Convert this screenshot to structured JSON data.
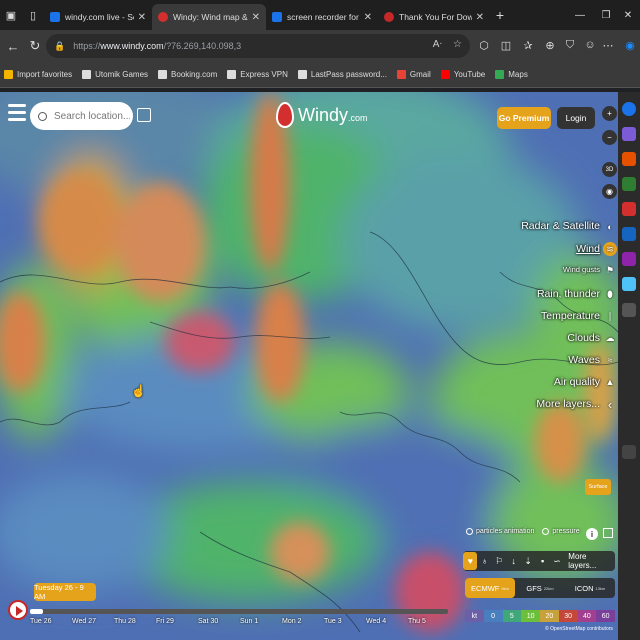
{
  "browser": {
    "tabs": [
      {
        "title": "windy.com live - Search",
        "active": false,
        "favicon_color": "#1a73e8"
      },
      {
        "title": "Windy: Wind map & weather fore",
        "active": true,
        "favicon_color": "#d32f2f"
      },
      {
        "title": "screen recorder for windows 11",
        "active": false,
        "favicon_color": "#1a73e8"
      },
      {
        "title": "Thank You For Downloading Scr",
        "active": false,
        "favicon_color": "#c62828"
      }
    ],
    "new_tab_label": "+",
    "url_prefix": "https://",
    "url_host": "www.windy.com",
    "url_path": "/?76.269,140.098,3",
    "bookmarks": [
      {
        "label": "Import favorites",
        "color": "#f4b400"
      },
      {
        "label": "Utomik Games",
        "color": "#ddd"
      },
      {
        "label": "Booking.com",
        "color": "#ddd"
      },
      {
        "label": "Express VPN",
        "color": "#ddd"
      },
      {
        "label": "LastPass password...",
        "color": "#ddd"
      },
      {
        "label": "Gmail",
        "color": "#ea4335"
      },
      {
        "label": "YouTube",
        "color": "#ff0000"
      },
      {
        "label": "Maps",
        "color": "#34a853"
      }
    ]
  },
  "app": {
    "search_placeholder": "Search location...",
    "logo_text": "Windy",
    "logo_suffix": ".com",
    "premium_label": "Go Premium",
    "login_label": "Login",
    "btn_3d": "3D",
    "layers": [
      {
        "label": "Radar & Satellite",
        "icon": "satellite-icon",
        "glyph": "◐"
      },
      {
        "label": "Wind",
        "icon": "wind-icon",
        "glyph": "≋",
        "active": true
      },
      {
        "label": "Wind gusts",
        "icon": "gusts-icon",
        "glyph": "⚑",
        "small": true
      },
      {
        "label": "Rain, thunder",
        "icon": "rain-icon",
        "glyph": "💧"
      },
      {
        "label": "Temperature",
        "icon": "thermometer-icon",
        "glyph": "❘"
      },
      {
        "label": "Clouds",
        "icon": "cloud-icon",
        "glyph": "☁"
      },
      {
        "label": "Waves",
        "icon": "waves-icon",
        "glyph": "≈"
      },
      {
        "label": "Air quality",
        "icon": "factory-icon",
        "glyph": "▲"
      },
      {
        "label": "More layers...",
        "icon": "chevron-left-icon",
        "glyph": "‹"
      }
    ],
    "surface_label": "Surface",
    "particles_label": "particles animation",
    "pressure_label": "pressure",
    "more_layers_label": "More layers...",
    "models": [
      {
        "name": "ECMWF",
        "res": "9km",
        "selected": true
      },
      {
        "name": "GFS",
        "res": "22km",
        "selected": false
      },
      {
        "name": "ICON",
        "res": "13km",
        "selected": false
      }
    ],
    "legend": {
      "unit": "kt",
      "values": [
        "0",
        "5",
        "10",
        "20",
        "30",
        "40",
        "60"
      ],
      "colors": [
        "#6b5fa8",
        "#4a7fbf",
        "#3fa77a",
        "#6cbf3a",
        "#c9a13a",
        "#c4473a",
        "#a33f8f",
        "#7a3f9a"
      ]
    },
    "osm_credit": "© OpenStreetMap contributors",
    "current_time": "Tuesday 26 - 9 AM",
    "timeline_progress": 0.03,
    "days": [
      "Tue 26",
      "Wed 27",
      "Thu 28",
      "Fri 29",
      "Sat 30",
      "Sun 1",
      "Mon 2",
      "Tue 3",
      "Wed 4",
      "Thu 5"
    ]
  }
}
